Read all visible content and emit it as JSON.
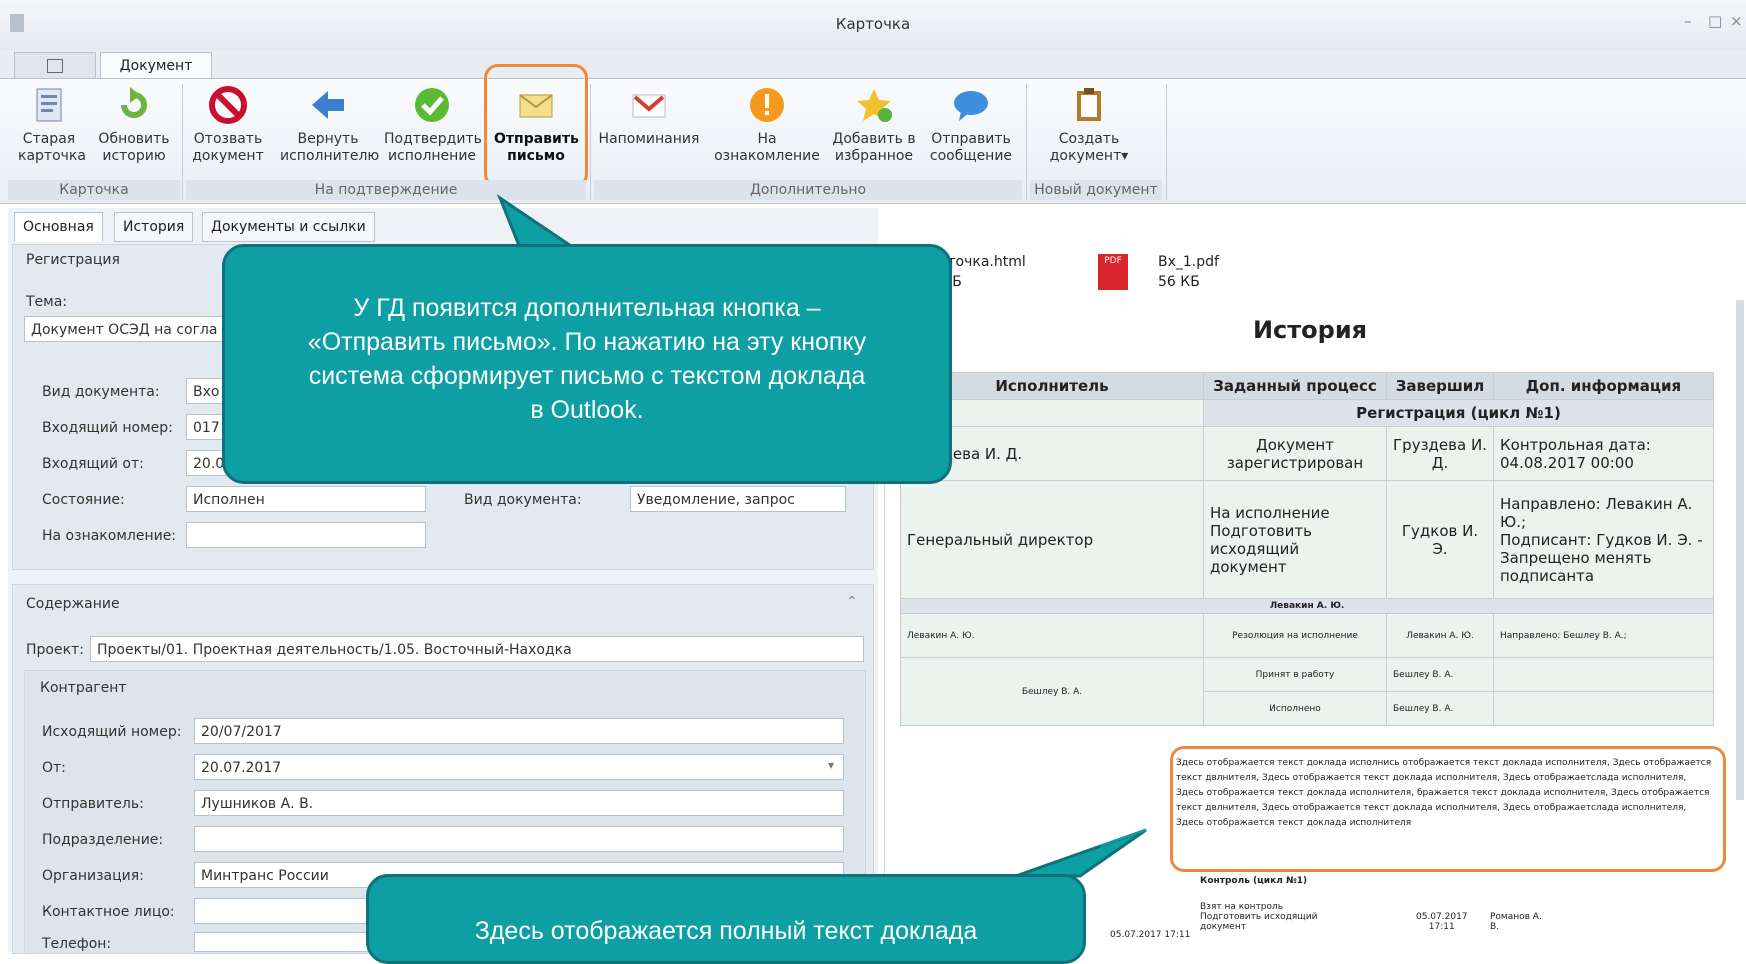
{
  "window": {
    "title": "Карточка",
    "controls": [
      "–",
      "□",
      "×"
    ]
  },
  "ribbon": {
    "tabs": [
      {
        "label": ""
      },
      {
        "label": "Документ"
      }
    ],
    "buttons": {
      "old_card": "Старая\nкарточка",
      "refresh": "Обновить\nисторию",
      "revoke": "Отозвать\nдокумент",
      "return": "Вернуть\nисполнителю",
      "confirm": "Подтвердить\nисполнение",
      "send_letter": "Отправить\nписьмо",
      "reminders": "Напоминания",
      "familiarize": "На\nознакомление",
      "favorites": "Добавить в\nизбранное",
      "send_message": "Отправить\nсообщение",
      "create_doc": "Создать\nдокумент▾"
    },
    "groups": {
      "card": "Карточка",
      "confirmation": "На подтверждение",
      "additional": "Дополнительно",
      "new_doc": "Новый документ"
    }
  },
  "subtabs": {
    "main": "Основная",
    "history": "История",
    "docs": "Документы и ссылки"
  },
  "form": {
    "registration": "Регистрация",
    "theme_label": "Тема:",
    "theme_value": "Документ ОСЭД на согла",
    "doc_type_label": "Вид документа:",
    "doc_type_value": "Вхо",
    "in_number_label": "Входящий номер:",
    "in_number_value": "017",
    "in_from_label": "Входящий от:",
    "in_from_value": "20.0",
    "state_label": "Состояние:",
    "state_value": "Исполнен",
    "familiar_label": "На ознакомление:",
    "familiar_value": "",
    "doc_type2_label": "Вид документа:",
    "doc_type2_value": "Уведомление, запрос",
    "content": "Содержание",
    "project_label": "Проект:",
    "project_value": "Проекты/01. Проектная деятельность/1.05. Восточный-Находка",
    "counterparty": "Контрагент",
    "out_number_label": "Исходящий номер:",
    "out_number_value": "20/07/2017",
    "from_label": "От:",
    "from_value": "20.07.2017",
    "sender_label": "Отправитель:",
    "sender_value": "Лушников А. В.",
    "division_label": "Подразделение:",
    "division_value": "",
    "org_label": "Организация:",
    "org_value": "Минтранс России",
    "contact_label": "Контактное лицо:",
    "contact_value": "",
    "phone_label": "Телефон:",
    "phone_value": ""
  },
  "attachments": [
    {
      "name": "Карточка.html",
      "size": "20 КБ"
    },
    {
      "name": "Вх_1.pdf",
      "size": "56 КБ"
    }
  ],
  "history": {
    "title": "История",
    "headers": [
      "Исполнитель",
      "Заданный процесс",
      "Завершил",
      "Доп. информация"
    ],
    "section1": "Регистрация (цикл №1)",
    "row1": [
      "Груздева И. Д.",
      "Документ зарегистрирован",
      "Груздева И. Д.",
      "Контрольная дата: 04.08.2017 00:00"
    ],
    "row2": [
      "Генеральный директор",
      "На исполнение\nПодготовить исходящий документ",
      "Гудков И. Э.",
      "Направлено: Левакин А. Ю.;\nПодписант: Гудков И. Э. - Запрещено менять подписанта"
    ],
    "section2": "Левакин А. Ю.",
    "row3": [
      "Левакин А. Ю.",
      "Резолюция на исполнение",
      "Левакин А. Ю.",
      "Направлено: Бешлеу В. А.;"
    ],
    "row4_performer": "Бешлеу В. А.",
    "row4a": [
      "Принят в работу",
      "Бешлеу В. А."
    ],
    "row4b": [
      "Исполнено",
      "Бешлеу В. А."
    ],
    "report_text": "Здесь отображается текст доклада исполнись отображается текст доклада исполнителя, Здесь отображается текст двлнителя, Здесь отображается текст доклада исполнителя, Здесь отображаетслада исполнителя, Здесь отображается текст доклада исполнителя, бражается текст доклада исполнителя, Здесь отображается текст двлнителя, Здесь отображается текст доклада исполнителя, Здесь отображаетслада исполнителя, Здесь отображается текст доклада исполнителя",
    "section3": "Контроль (цикл №1)",
    "row5": [
      "05.07.2017 17:11",
      "Взят на контроль\nПодготовить исходящий документ",
      "05.07.2017\n17:11",
      "Романов А. В."
    ]
  },
  "callouts": {
    "top": "У ГД появится дополнительная кнопка –\n«Отправить письмо». По нажатию на эту кнопку\nсистема сформирует письмо с текстом доклада\nв Outlook.",
    "bottom": "Здесь отображается полный текст доклада"
  },
  "colors": {
    "callout_fill": "#0d9fa3",
    "highlight": "#f0883a"
  }
}
